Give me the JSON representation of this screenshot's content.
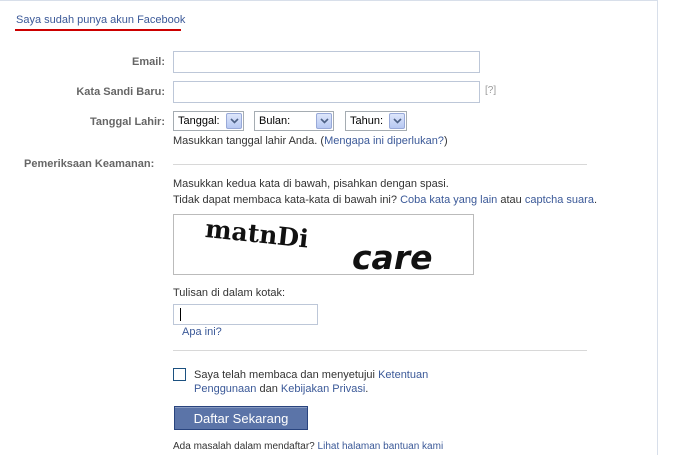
{
  "top_link": "Saya sudah punya akun Facebook",
  "accent_underline": "#cc0000",
  "form": {
    "email_label": "Email:",
    "email_value": "",
    "password_label": "Kata Sandi Baru:",
    "password_value": "",
    "password_help": "[?]",
    "birthday_label": "Tanggal Lahir:",
    "day_select": "Tanggal:",
    "month_select": "Bulan:",
    "year_select": "Tahun:",
    "birthday_hint": "Masukkan tanggal lahir Anda.",
    "birthday_hint_link": "Mengapa ini diperlukan?",
    "paren_open": "(",
    "paren_close": ")"
  },
  "security": {
    "heading": "Pemeriksaan Keamanan:",
    "instruction1": "Masukkan kedua kata di bawah, pisahkan dengan spasi.",
    "instruction2_prefix": "Tidak dapat membaca kata-kata di bawah ini?",
    "try_other_link": "Coba kata yang lain",
    "or_text": "atau",
    "audio_link": "captcha suara",
    "period": ".",
    "captcha_word1": "matnDi",
    "captcha_word2": "care",
    "text_in_box_label": "Tulisan di dalam kotak:",
    "text_in_box_value": "",
    "what_is_this_link": "Apa ini?"
  },
  "terms": {
    "text1": "Saya telah membaca dan menyetujui",
    "terms_link_part1": "Ketentuan",
    "terms_link_part2": "Penggunaan",
    "and_text": "dan",
    "privacy_link": "Kebijakan Privasi",
    "period": "."
  },
  "submit_label": "Daftar Sekarang",
  "help": {
    "prefix": "Ada masalah dalam mendaftar?",
    "link": "Lihat halaman bantuan kami"
  },
  "colors": {
    "link": "#3b5998",
    "button": "#5b74a8",
    "input_border": "#bdc7d8"
  },
  "icons": {
    "select_arrow": "chevron-down-icon",
    "checkbox": "checkbox-icon"
  }
}
